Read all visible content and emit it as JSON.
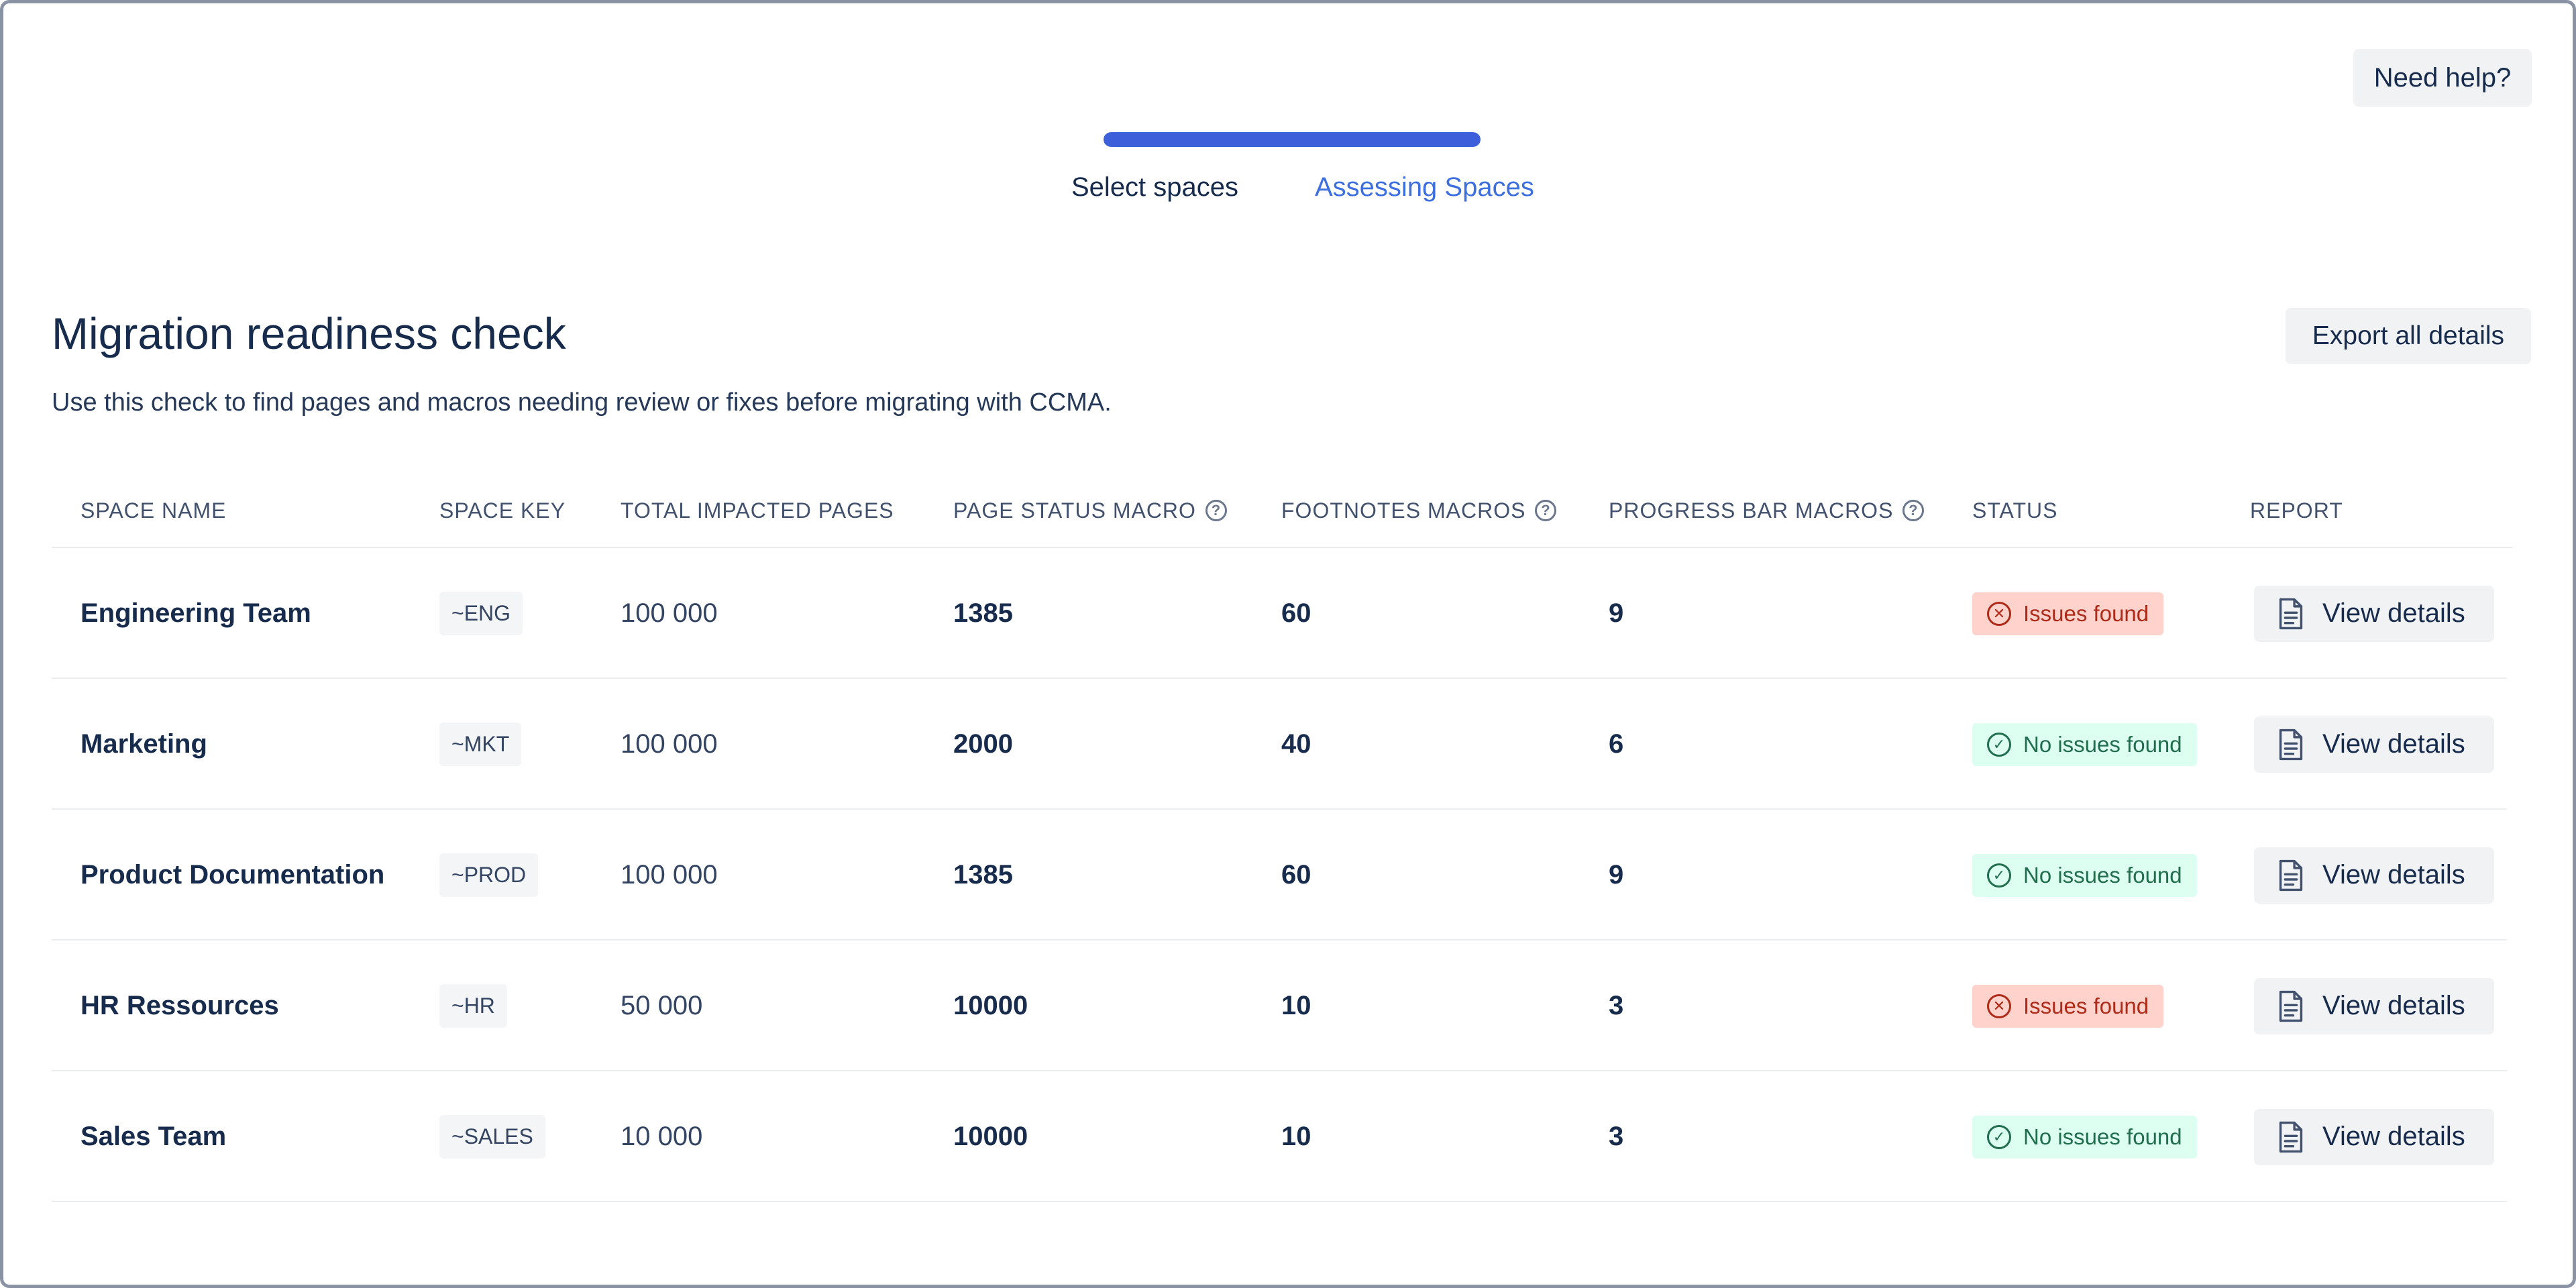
{
  "header": {
    "help_label": "Need help?"
  },
  "stepper": {
    "progress": 1.0,
    "steps": [
      {
        "label": "Select spaces"
      },
      {
        "label": "Assessing Spaces"
      }
    ],
    "active_color": "#3d5fd9"
  },
  "main": {
    "title": "Migration readiness check",
    "description": "Use this check to find pages and macros needing review or fixes before migrating with CCMA.",
    "export_label": "Export all details"
  },
  "table": {
    "columns": [
      "SPACE NAME",
      "SPACE KEY",
      "TOTAL IMPACTED PAGES",
      "PAGE STATUS MACRO",
      "FOOTNOTES MACROS",
      "PROGRESS BAR MACROS",
      "STATUS",
      "REPORT"
    ],
    "help_icon_glyph": "?",
    "rows": [
      {
        "name": "Engineering Team",
        "key": "~ENG",
        "pages": "100 000",
        "page_status": "1385",
        "footnotes": "60",
        "progress": "9",
        "status": "Issues found",
        "status_kind": "error",
        "report": "View details"
      },
      {
        "name": "Marketing",
        "key": "~MKT",
        "pages": "100 000",
        "page_status": "2000",
        "footnotes": "40",
        "progress": "6",
        "status": "No issues found",
        "status_kind": "ok",
        "report": "View details"
      },
      {
        "name": "Product Documentation",
        "key": "~PROD",
        "pages": "100 000",
        "page_status": "1385",
        "footnotes": "60",
        "progress": "9",
        "status": "No issues found",
        "status_kind": "ok",
        "report": "View details"
      },
      {
        "name": "HR Ressources",
        "key": "~HR",
        "pages": "50 000",
        "page_status": "10000",
        "footnotes": "10",
        "progress": "3",
        "status": "Issues found",
        "status_kind": "error",
        "report": "View details"
      },
      {
        "name": "Sales Team",
        "key": "~SALES",
        "pages": "10 000",
        "page_status": "10000",
        "footnotes": "10",
        "progress": "3",
        "status": "No issues found",
        "status_kind": "ok",
        "report": "View details"
      }
    ]
  },
  "colors": {
    "error_bg": "#ffd2cc",
    "error_fg": "#ae2a19",
    "ok_bg": "#dcfff1",
    "ok_fg": "#216e4e"
  },
  "icons": {
    "status_error": "x-circle-icon",
    "status_ok": "check-circle-icon",
    "report": "document-icon",
    "column_help": "help-circle-icon"
  }
}
